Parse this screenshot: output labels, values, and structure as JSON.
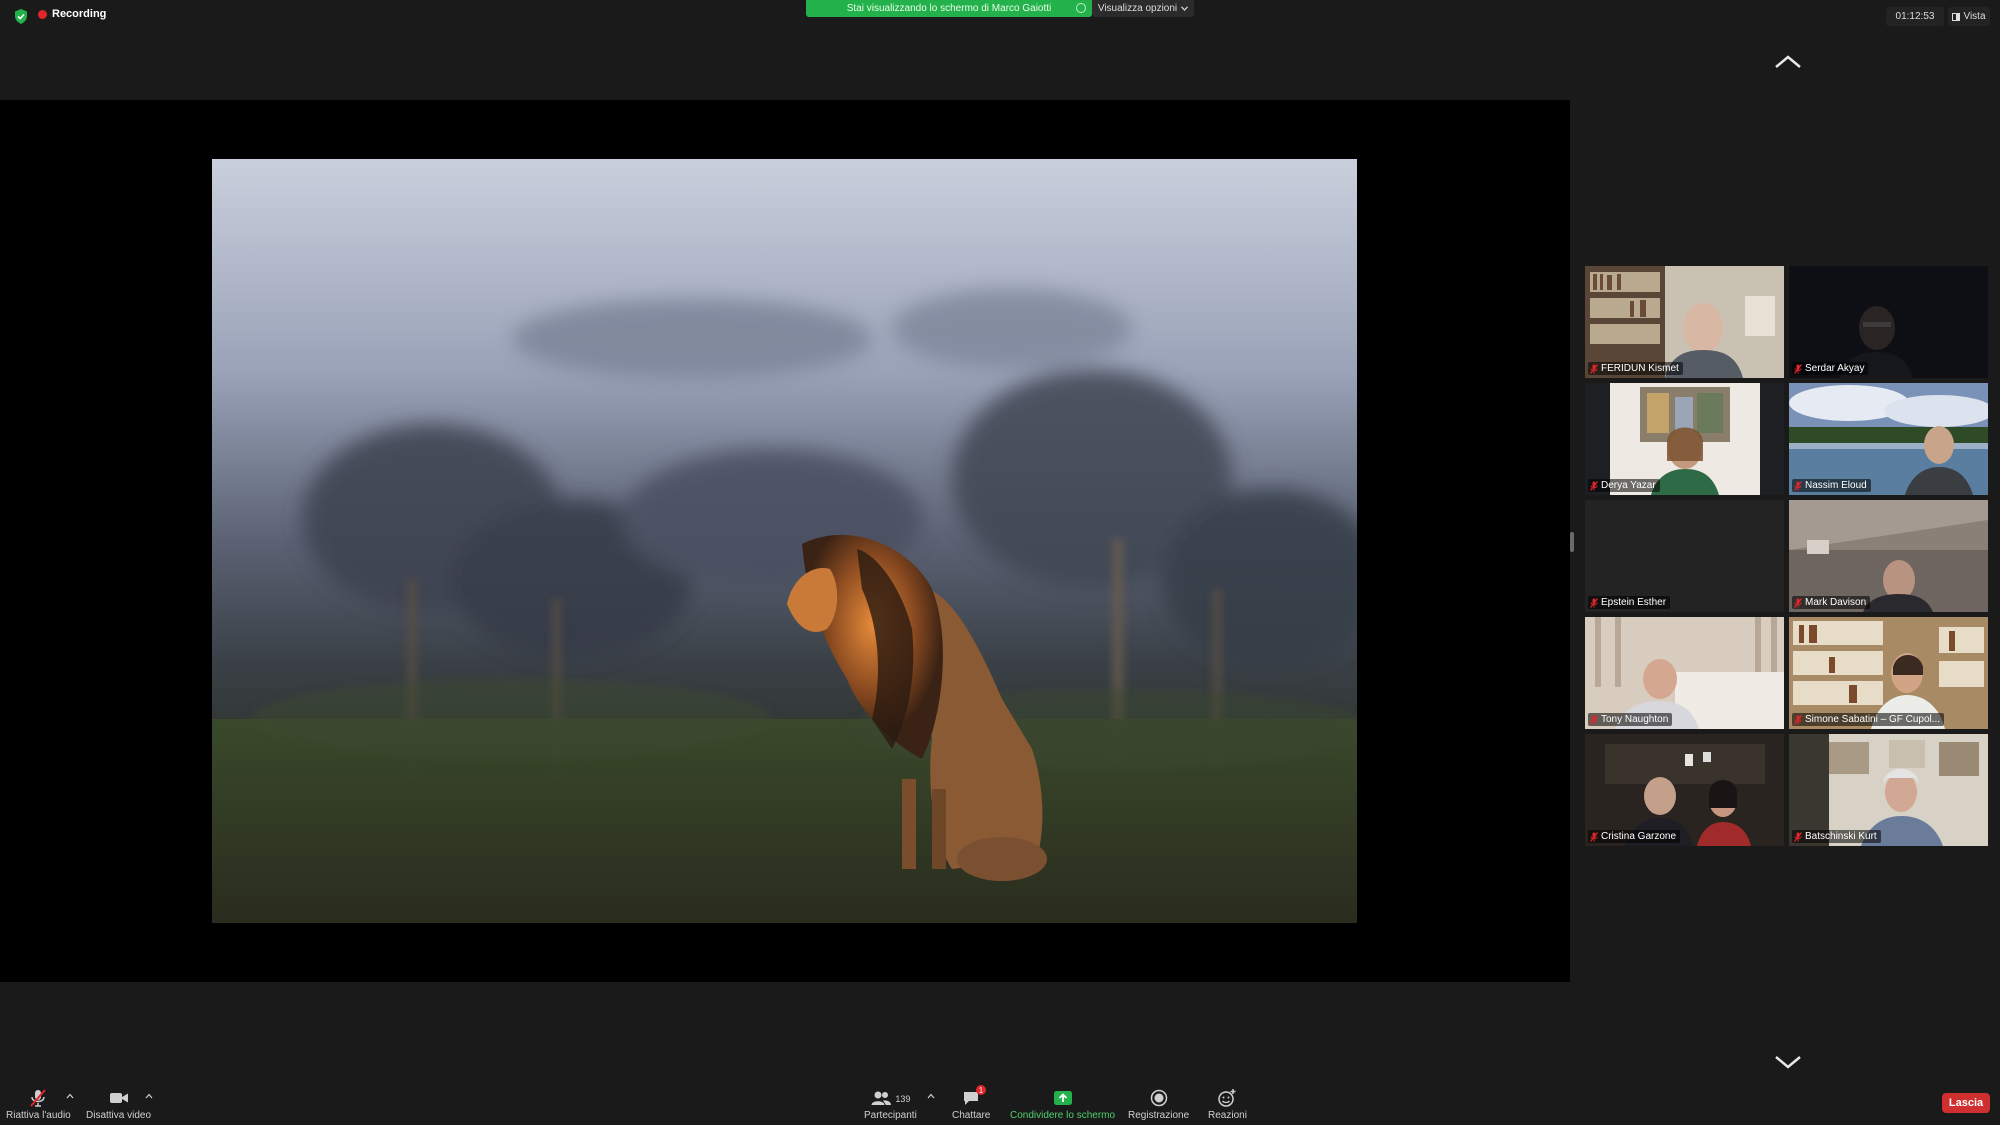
{
  "top_bar": {
    "recording_label": "Recording",
    "share_banner_text": "Stai visualizzando lo schermo di Marco Gaiotti",
    "view_options_label": "Visualizza opzioni",
    "meeting_timer": "01:12:53",
    "view_label": "Vista"
  },
  "shared_content": {
    "description_icon": "lion-photo"
  },
  "participants": [
    {
      "name": "FERIDUN Kismet",
      "muted": true
    },
    {
      "name": "Serdar Akyay",
      "muted": true
    },
    {
      "name": "Derya Yazar",
      "muted": true
    },
    {
      "name": "Nassim Eloud",
      "muted": true
    },
    {
      "name": "Epstein Esther",
      "muted": true
    },
    {
      "name": "Mark Davison",
      "muted": true
    },
    {
      "name": "Tony Naughton",
      "muted": true
    },
    {
      "name": "Simone Sabatini – GF Cupol...",
      "muted": true
    },
    {
      "name": "Cristina Garzone",
      "muted": true
    },
    {
      "name": "Batschinski Kurt",
      "muted": true
    }
  ],
  "toolbar": {
    "unmute_label": "Riattiva l'audio",
    "stop_video_label": "Disattiva video",
    "participants_label": "Partecipanti",
    "participants_count": "139",
    "chat_label": "Chattare",
    "chat_badge": "1",
    "share_label": "Condividere lo schermo",
    "record_label": "Registrazione",
    "reactions_label": "Reazioni",
    "leave_label": "Lascia"
  },
  "colors": {
    "background": "#1a1a1a",
    "share_green": "#23b14b",
    "record_red": "#e0262a",
    "leave_red": "#d02f2f",
    "mute_red": "#e0262a"
  }
}
